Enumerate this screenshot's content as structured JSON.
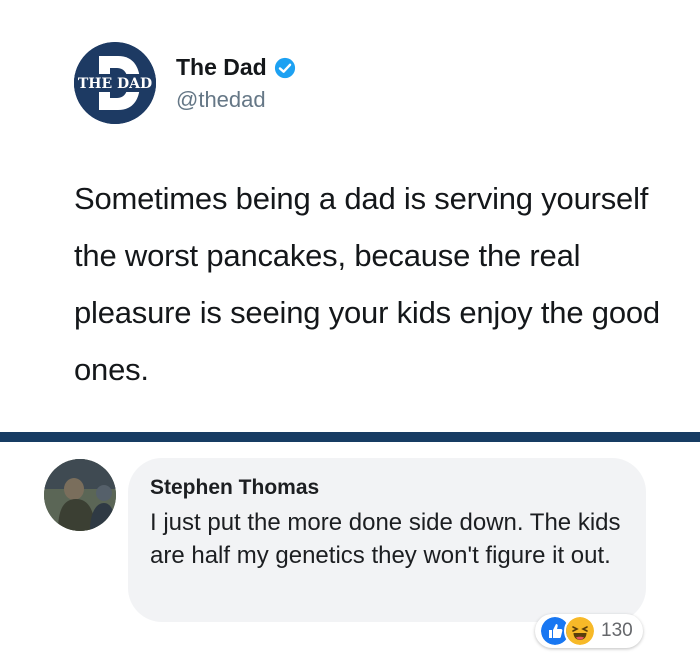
{
  "tweet": {
    "logo_text": "THE DAD",
    "author_name": "The Dad",
    "author_handle": "@thedad",
    "text": "Sometimes being a dad is serving yourself the worst pancakes, because the real pleasure is seeing your kids enjoy the good ones."
  },
  "comment": {
    "author_name": "Stephen Thomas",
    "text": "I just put the more done side down. The kids are half my genetics they won't figure it out.",
    "reactions": [
      "like-icon",
      "haha-icon"
    ],
    "reaction_count": "130"
  },
  "colors": {
    "brand_navy": "#1d3a63",
    "divider": "#173c63",
    "verified_blue": "#1da1f2",
    "bubble": "#f2f3f5",
    "like_blue": "#1877f2",
    "haha_yellow": "#f7b928"
  }
}
